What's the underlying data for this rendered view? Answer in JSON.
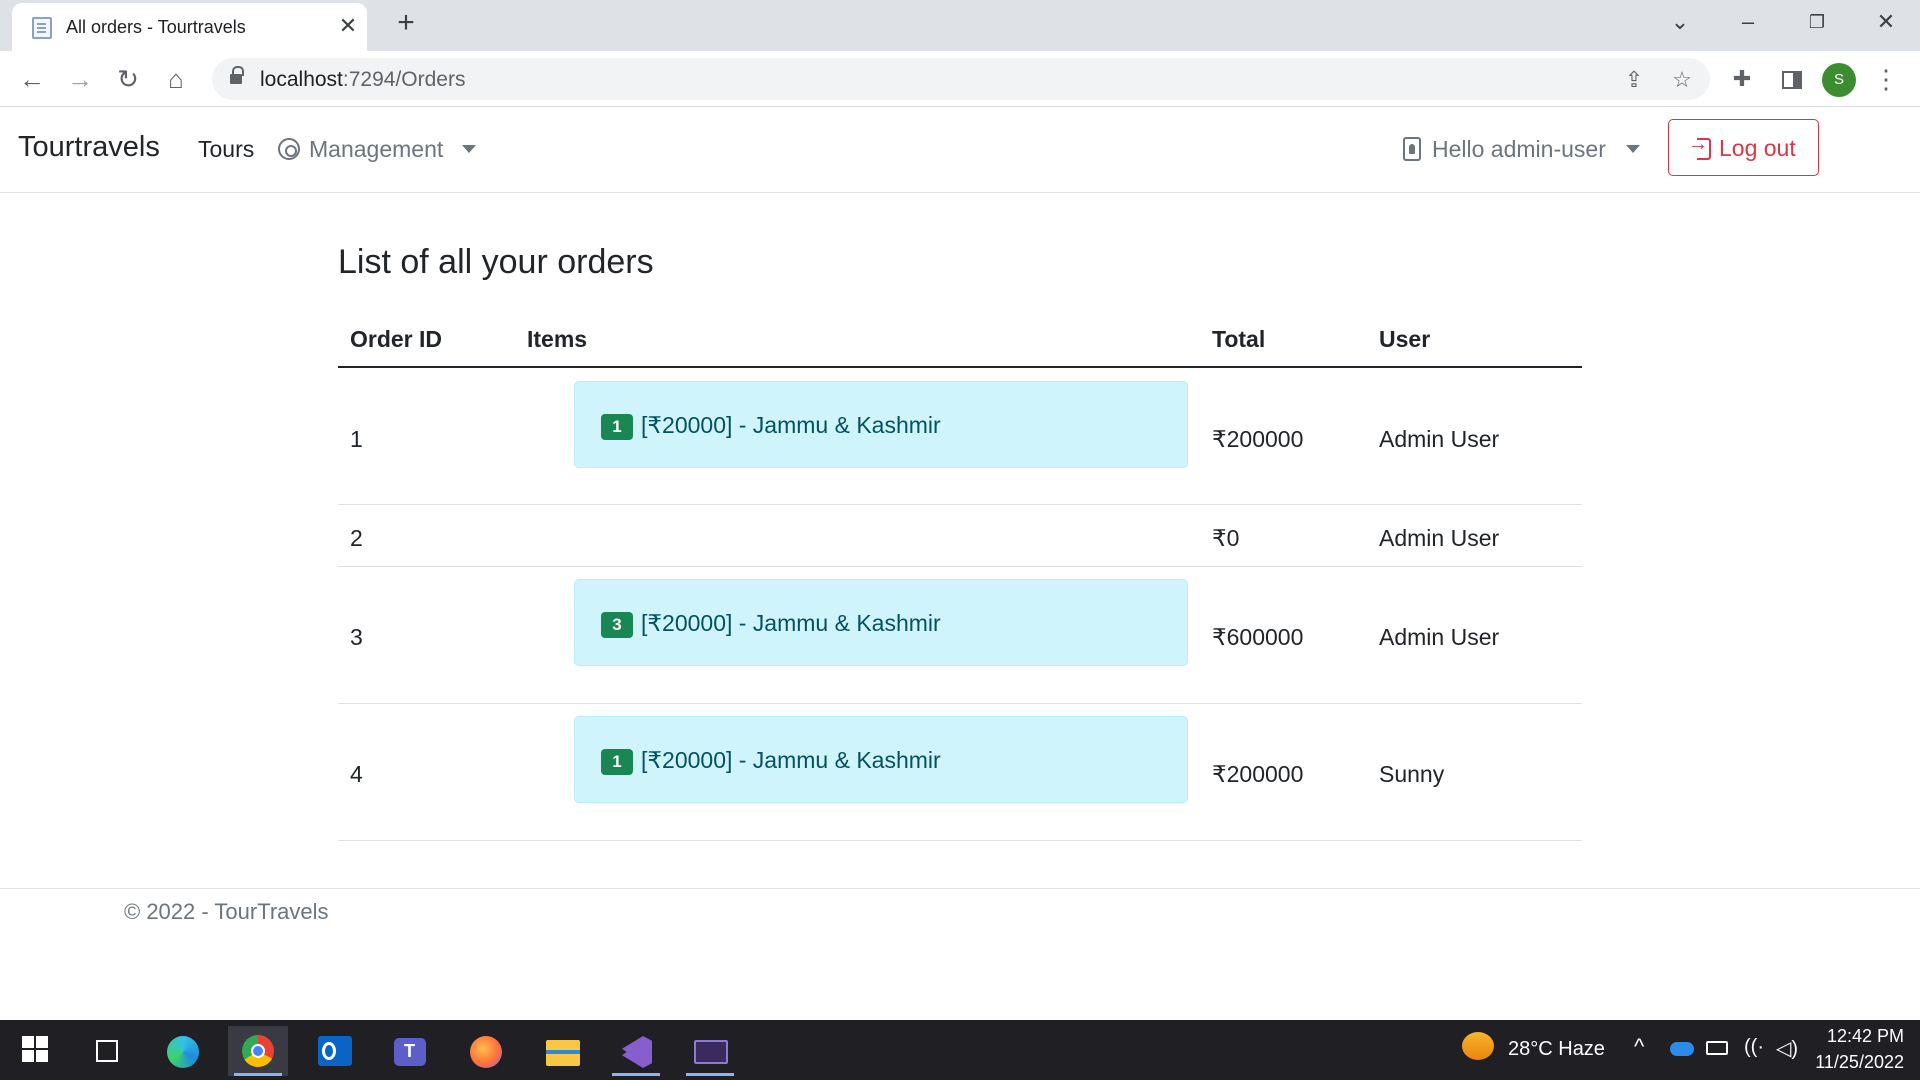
{
  "browser": {
    "tab_title": "All orders - Tourtravels",
    "url_host": "localhost",
    "url_path": ":7294/Orders",
    "profile_initial": "S"
  },
  "navbar": {
    "brand": "Tourtravels",
    "tours": "Tours",
    "management": "Management",
    "user_greeting": "Hello admin-user",
    "logout": "Log out"
  },
  "page": {
    "heading": "List of all your orders",
    "columns": [
      "Order ID",
      "Items",
      "Total",
      "User"
    ],
    "orders": [
      {
        "id": "1",
        "item_qty": "1",
        "item_text": "[₹20000] - Jammu & Kashmir",
        "total": "₹200000",
        "user": "Admin User"
      },
      {
        "id": "2",
        "item_qty": "",
        "item_text": "",
        "total": "₹0",
        "user": "Admin User"
      },
      {
        "id": "3",
        "item_qty": "3",
        "item_text": "[₹20000] - Jammu & Kashmir",
        "total": "₹600000",
        "user": "Admin User"
      },
      {
        "id": "4",
        "item_qty": "1",
        "item_text": "[₹20000] - Jammu & Kashmir",
        "total": "₹200000",
        "user": "Sunny"
      }
    ]
  },
  "footer": {
    "text": "© 2022 - TourTravels"
  },
  "taskbar": {
    "weather": "28°C  Haze",
    "time": "12:42 PM",
    "date": "11/25/2022"
  },
  "colors": {
    "accent_danger": "#dc3545",
    "badge_success": "#198754",
    "alert_info_bg": "#cff4fc",
    "alert_info_text": "#055160"
  }
}
